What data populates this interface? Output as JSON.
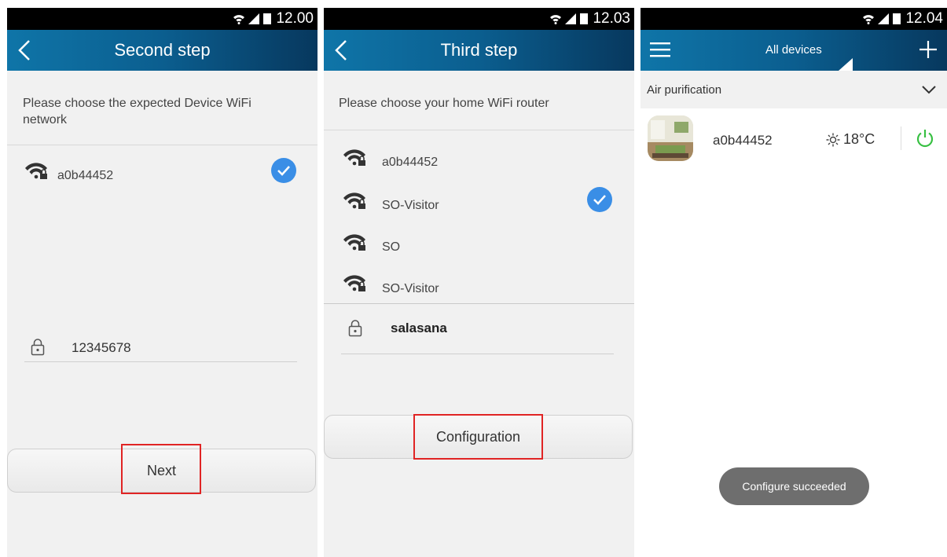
{
  "status": {
    "time_1": "12.00",
    "time_2": "12.03",
    "time_3": "12.04"
  },
  "screen1": {
    "title": "Second step",
    "hint": "Please choose the expected Device WiFi network",
    "network": "a0b44452",
    "password": "12345678",
    "button": "Next"
  },
  "screen2": {
    "title": "Third step",
    "hint": "Please choose your home WiFi router",
    "networks": [
      "a0b44452",
      "SO-Visitor",
      "SO",
      "SO-Visitor"
    ],
    "password": "salasana",
    "button": "Configuration"
  },
  "screen3": {
    "title": "All devices",
    "category": "Air purification",
    "device_name": "a0b44452",
    "temperature": "18°C",
    "toast": "Configure succeeded"
  },
  "colors": {
    "appbar": "#0b5e8f",
    "check": "#3a8ee6",
    "highlight": "#e02424",
    "power": "#38c043"
  }
}
